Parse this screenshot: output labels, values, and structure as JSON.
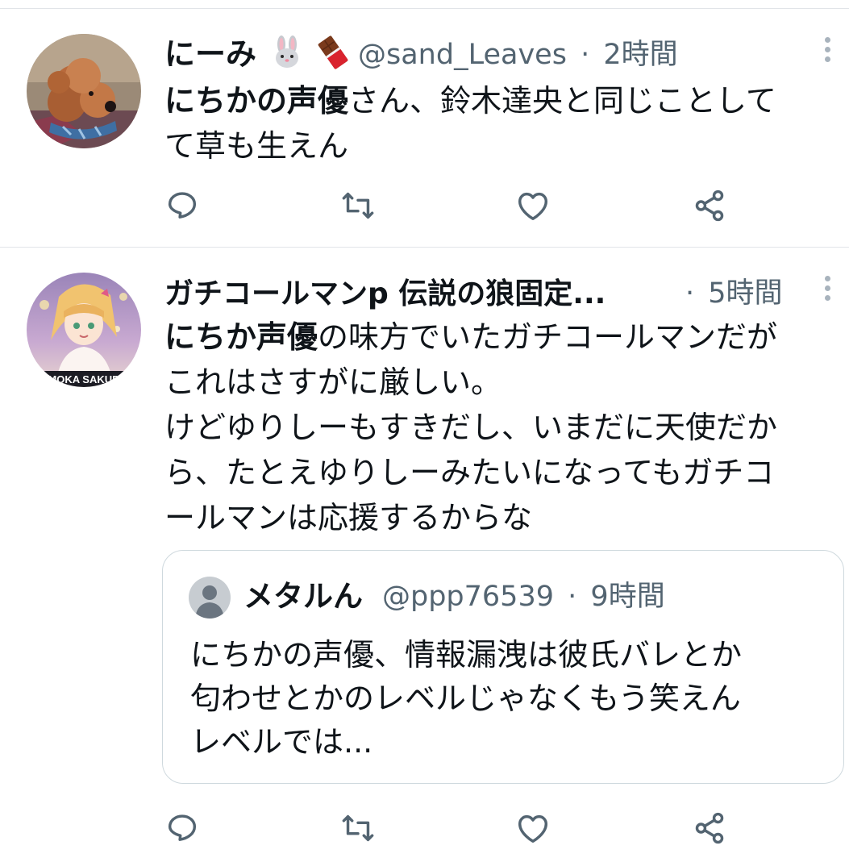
{
  "tweets": [
    {
      "display_name": "にーみ",
      "name_emojis": [
        "rabbit-face",
        "chocolate-bar"
      ],
      "handle": "@sand_Leaves",
      "separator": "·",
      "time": "2時間",
      "lines": [
        [
          {
            "t": "にちかの声優",
            "b": true
          },
          {
            "t": "さん、鈴木達央と同じことして",
            "b": false
          }
        ],
        [
          {
            "t": "て草も生えん",
            "b": false
          }
        ]
      ]
    },
    {
      "display_name": "ガチコールマンp 伝説の狼固定...",
      "separator": "·",
      "time": "5時間",
      "avatar_text": "MOKA SAKUR",
      "lines": [
        [
          {
            "t": "にちか声優",
            "b": true
          },
          {
            "t": "の味方でいたガチコールマンだが",
            "b": false
          }
        ],
        [
          {
            "t": "これはさすがに厳しい。",
            "b": false
          }
        ],
        [
          {
            "t": "けどゆりしーもすきだし、いまだに天使だか",
            "b": false
          }
        ],
        [
          {
            "t": "ら、たとえゆりしーみたいになってもガチコ",
            "b": false
          }
        ],
        [
          {
            "t": "ールマンは応援するからな",
            "b": false
          }
        ]
      ],
      "quote": {
        "display_name": "メタルん",
        "handle": "@ppp76539",
        "separator": "·",
        "time": "9時間",
        "lines": [
          "にちかの声優、情報漏洩は彼氏バレとか",
          "匂わせとかのレベルじゃなくもう笑えん",
          "レベルでは..."
        ]
      }
    }
  ],
  "actions": [
    "reply-icon",
    "retweet-icon",
    "like-icon",
    "share-icon"
  ],
  "colors": {
    "text": "#0f1419",
    "secondary": "#536471",
    "icon": "#536471",
    "divider": "#e1e4e8",
    "quote_border": "#cfd9de"
  }
}
